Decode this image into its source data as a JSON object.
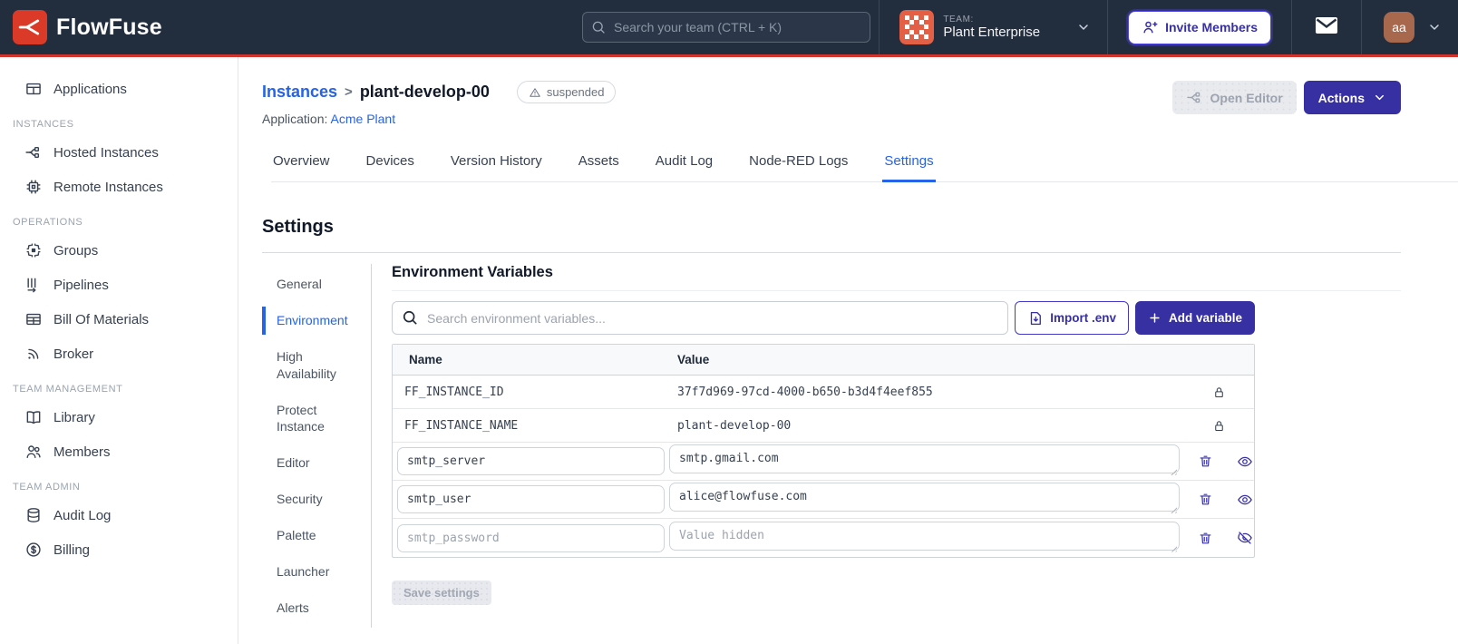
{
  "colors": {
    "navbar_bg": "#222D3D",
    "accent_red": "#D0342C",
    "brand_red": "#DC3A28",
    "indigo": "#3730A3",
    "link_blue": "#2563EB"
  },
  "navbar": {
    "brand": "FlowFuse",
    "search_placeholder": "Search your team (CTRL + K)",
    "team_label": "TEAM:",
    "team_name": "Plant Enterprise",
    "invite_button": "Invite Members",
    "avatar_initials": "aa"
  },
  "sidebar": {
    "items_top": [
      {
        "icon": "applications-icon",
        "label": "Applications"
      }
    ],
    "sections": [
      {
        "title": "INSTANCES",
        "items": [
          {
            "icon": "hosted-instances-icon",
            "label": "Hosted Instances"
          },
          {
            "icon": "remote-instances-icon",
            "label": "Remote Instances"
          }
        ]
      },
      {
        "title": "OPERATIONS",
        "items": [
          {
            "icon": "groups-icon",
            "label": "Groups"
          },
          {
            "icon": "pipelines-icon",
            "label": "Pipelines"
          },
          {
            "icon": "bill-of-materials-icon",
            "label": "Bill Of Materials"
          },
          {
            "icon": "broker-icon",
            "label": "Broker"
          }
        ]
      },
      {
        "title": "TEAM MANAGEMENT",
        "items": [
          {
            "icon": "library-icon",
            "label": "Library"
          },
          {
            "icon": "members-icon",
            "label": "Members"
          }
        ]
      },
      {
        "title": "TEAM ADMIN",
        "items": [
          {
            "icon": "audit-log-icon",
            "label": "Audit Log"
          },
          {
            "icon": "billing-icon",
            "label": "Billing"
          }
        ]
      }
    ]
  },
  "header": {
    "breadcrumb_parent": "Instances",
    "breadcrumb_separator": ">",
    "breadcrumb_current": "plant-develop-00",
    "status_badge": "suspended",
    "application_label": "Application:",
    "application_name": "Acme Plant",
    "open_editor_button": "Open Editor",
    "actions_button": "Actions"
  },
  "tabs": {
    "items": [
      {
        "label": "Overview"
      },
      {
        "label": "Devices"
      },
      {
        "label": "Version History"
      },
      {
        "label": "Assets"
      },
      {
        "label": "Audit Log"
      },
      {
        "label": "Node-RED Logs"
      },
      {
        "label": "Settings"
      }
    ],
    "active": "Settings"
  },
  "settings": {
    "title": "Settings",
    "nav": [
      {
        "label": "General"
      },
      {
        "label": "Environment"
      },
      {
        "label": "High Availability"
      },
      {
        "label": "Protect Instance"
      },
      {
        "label": "Editor"
      },
      {
        "label": "Security"
      },
      {
        "label": "Palette"
      },
      {
        "label": "Launcher"
      },
      {
        "label": "Alerts"
      }
    ],
    "active": "Environment"
  },
  "env": {
    "title": "Environment Variables",
    "search_placeholder": "Search environment variables...",
    "import_button": "Import .env",
    "add_button": "Add variable",
    "table": {
      "columns": [
        {
          "label": "Name"
        },
        {
          "label": "Value"
        }
      ],
      "locked_rows": [
        {
          "name": "FF_INSTANCE_ID",
          "value": "37f7d969-97cd-4000-b650-b3d4f4eef855"
        },
        {
          "name": "FF_INSTANCE_NAME",
          "value": "plant-develop-00"
        }
      ],
      "editable_rows": [
        {
          "name": "smtp_server",
          "value": "smtp.gmail.com"
        },
        {
          "name": "smtp_user",
          "value": "alice@flowfuse.com"
        },
        {
          "name": "smtp_password",
          "value": "",
          "value_placeholder": "Value hidden"
        }
      ]
    },
    "save_button": "Save settings"
  }
}
